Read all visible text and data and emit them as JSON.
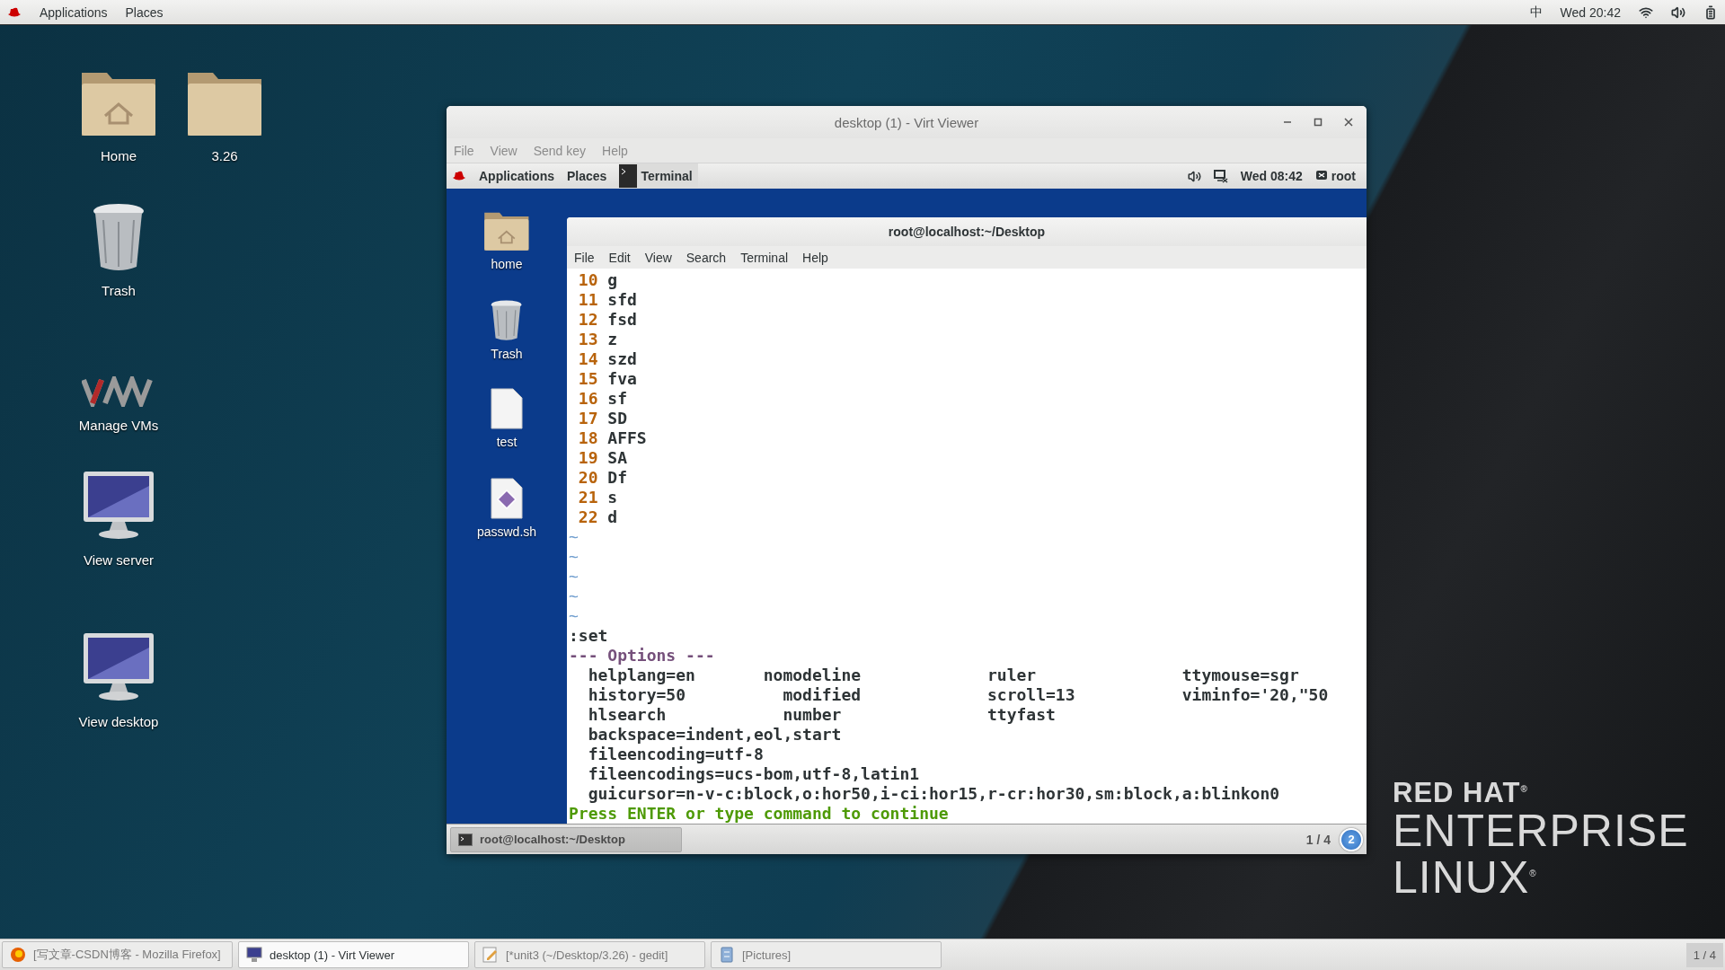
{
  "top_bar": {
    "menus": [
      "Applications",
      "Places"
    ],
    "input_method": "中",
    "clock": "Wed 20:42"
  },
  "desktop_icons": [
    {
      "label": "Home",
      "kind": "home-folder"
    },
    {
      "label": "3.26",
      "kind": "folder"
    },
    {
      "label": "Trash",
      "kind": "trash"
    },
    {
      "label": "Manage VMs",
      "kind": "vm"
    },
    {
      "label": "View server",
      "kind": "monitor"
    },
    {
      "label": "View desktop",
      "kind": "monitor"
    }
  ],
  "viewer_window": {
    "title": "desktop (1) - Virt Viewer",
    "menus": [
      "File",
      "View",
      "Send key",
      "Help"
    ],
    "guest_panel": {
      "menus": [
        "Applications",
        "Places"
      ],
      "task": "Terminal",
      "clock": "Wed 08:42",
      "user": "root"
    },
    "guest_icons": [
      {
        "label": "home",
        "kind": "home-folder"
      },
      {
        "label": "Trash",
        "kind": "trash"
      },
      {
        "label": "test",
        "kind": "document"
      },
      {
        "label": "passwd.sh",
        "kind": "script"
      }
    ],
    "terminal": {
      "title": "root@localhost:~/Desktop",
      "menus": [
        "File",
        "Edit",
        "View",
        "Search",
        "Terminal",
        "Help"
      ],
      "lines": [
        {
          "number": "10",
          "text": "g"
        },
        {
          "number": "11",
          "text": "sfd"
        },
        {
          "number": "12",
          "text": "fsd"
        },
        {
          "number": "13",
          "text": "z"
        },
        {
          "number": "14",
          "text": "szd"
        },
        {
          "number": "15",
          "text": "fva"
        },
        {
          "number": "16",
          "text": "sf"
        },
        {
          "number": "17",
          "text": "SD"
        },
        {
          "number": "18",
          "text": "AFFS"
        },
        {
          "number": "19",
          "text": "SA"
        },
        {
          "number": "20",
          "text": "Df"
        },
        {
          "number": "21",
          "text": "s"
        },
        {
          "number": "22",
          "text": "d"
        }
      ],
      "tildes": [
        "~",
        "~",
        "~",
        "~",
        "~"
      ],
      "command": ":set",
      "options_heading": "--- Options ---",
      "option_rows": [
        [
          "helplang=en",
          "nomodeline",
          "ruler",
          "ttymouse=sgr"
        ],
        [
          "history=50",
          "  modified",
          "scroll=13",
          "viminfo='20,\"50"
        ],
        [
          "hlsearch",
          "  number",
          "ttyfast"
        ]
      ],
      "option_lines": [
        "backspace=indent,eol,start",
        "fileencoding=utf-8",
        "fileencodings=ucs-bom,utf-8,latin1",
        "guicursor=n-v-c:block,o:hor50,i-ci:hor15,r-cr:hor30,sm:block,a:blinkon0"
      ],
      "prompt": "Press ENTER or type command to continue"
    },
    "guest_bottom_bar": {
      "task": "root@localhost:~/Desktop",
      "workspace": "1 / 4",
      "badge": "2"
    }
  },
  "wallpaper_logo": [
    "RED HAT$^{®}$",
    "ENTERPRISE",
    "LINUX$^{®}$"
  ],
  "taskbar": {
    "items": [
      {
        "label": "[写文章-CSDN博客 - Mozilla Firefox]",
        "selected": false
      },
      {
        "label": "desktop (1) - Virt Viewer",
        "selected": true
      },
      {
        "label": "[*unit3 (~/Desktop/3.26) - gedit]",
        "selected": false
      },
      {
        "label": "[Pictures]",
        "selected": false
      }
    ],
    "workspace": "1 / 4"
  }
}
